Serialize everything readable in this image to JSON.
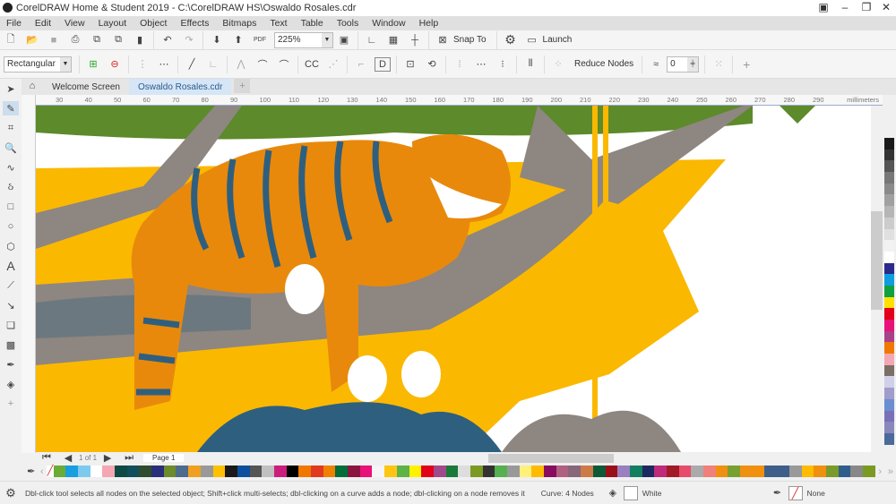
{
  "window": {
    "title": "CorelDRAW Home & Student 2019 - C:\\CorelDRAW HS\\Oswaldo Rosales.cdr",
    "controls": [
      "▣",
      "–",
      "❐",
      "✕"
    ]
  },
  "menu": [
    "File",
    "Edit",
    "View",
    "Layout",
    "Object",
    "Effects",
    "Bitmaps",
    "Text",
    "Table",
    "Tools",
    "Window",
    "Help"
  ],
  "toolbar": {
    "zoom_level": "225%",
    "snap_to": "Snap To",
    "launch": "Launch"
  },
  "property_bar": {
    "selection_mode": "Rectangular",
    "reduce_nodes": "Reduce Nodes",
    "curve_smoothing": "0"
  },
  "tabs": [
    {
      "label": "Welcome Screen",
      "active": false
    },
    {
      "label": "Oswaldo Rosales.cdr",
      "active": true
    }
  ],
  "ruler": {
    "ticks": [
      "30",
      "40",
      "50",
      "60",
      "70",
      "80",
      "90",
      "100",
      "110",
      "120",
      "130",
      "140",
      "150",
      "160",
      "170",
      "180",
      "190",
      "200",
      "210",
      "220",
      "230",
      "240",
      "250",
      "260",
      "270",
      "280",
      "290"
    ],
    "unit": "millimeters"
  },
  "page_nav": {
    "current": "1",
    "of": "of",
    "total": "1",
    "page_tab": "Page 1"
  },
  "palette": [
    "#6aac35",
    "#1a9ee0",
    "#7ccbef",
    "#ffffff",
    "#f4a7b3",
    "#0d4a44",
    "#114f5a",
    "#2f4d2c",
    "#2a2f7a",
    "#6c8b2a",
    "#4d6b8c",
    "#f0a020",
    "#999999",
    "#ffc000",
    "#1a1a1a",
    "#0c4f9e",
    "#555555",
    "#c0c0c0",
    "#cc1d7e",
    "#000000",
    "#f07800",
    "#e03a20",
    "#f08000",
    "#006d3a",
    "#8a1540",
    "#e8117a",
    "#f5f5f5",
    "#ffc510",
    "#5db348",
    "#fff200",
    "#e2001a",
    "#a04a8c",
    "#1a7a3a",
    "#dddddd",
    "#7b9a22",
    "#333333",
    "#55b050",
    "#999999",
    "#fff07a",
    "#ffbb00",
    "#8a0c5e",
    "#b06080",
    "#86687a",
    "#cc7a48",
    "#0d5a36",
    "#9a1018",
    "#9a80c0",
    "#128060",
    "#1c2a60",
    "#c02a7a",
    "#a01a28",
    "#e84a6a",
    "#aaaaaa",
    "#f0807a",
    "#f09010",
    "#78a030",
    "#f09010",
    "#f0900c",
    "#3d5f8a",
    "#3d5f8a",
    "#999999",
    "#ffbb00",
    "#f09010",
    "#7a9a2a",
    "#2f5f8a",
    "#888888",
    "#7a9a22"
  ],
  "right_palette": [
    "#1a1a1a",
    "#333333",
    "#555555",
    "#777777",
    "#8a8a8a",
    "#a0a0a0",
    "#b5b5b5",
    "#cccccc",
    "#e0e0e0",
    "#f2f2f2",
    "#ffffff",
    "#2a2a8a",
    "#0e9ee0",
    "#10a040",
    "#ffe000",
    "#e2001a",
    "#e8117a",
    "#a8408a",
    "#f07800",
    "#f4a7b3",
    "#7a6e66",
    "#d0d0ea",
    "#a09ccc",
    "#6a8ed0",
    "#7a70b8",
    "#8888bb",
    "#4a6a9a"
  ],
  "status": {
    "hint": "Dbl-click tool selects all nodes on the selected object; Shift+click multi-selects; dbl-clicking on a curve adds a node; dbl-clicking on a node removes it",
    "object_info": "Curve: 4 Nodes",
    "fill": "White",
    "outline": "None"
  },
  "colors": {
    "orange": "#e8890c",
    "yellow": "#fbb800",
    "blue": "#2e5f7f",
    "gray": "#8e8680",
    "green": "#5d8a2a"
  }
}
